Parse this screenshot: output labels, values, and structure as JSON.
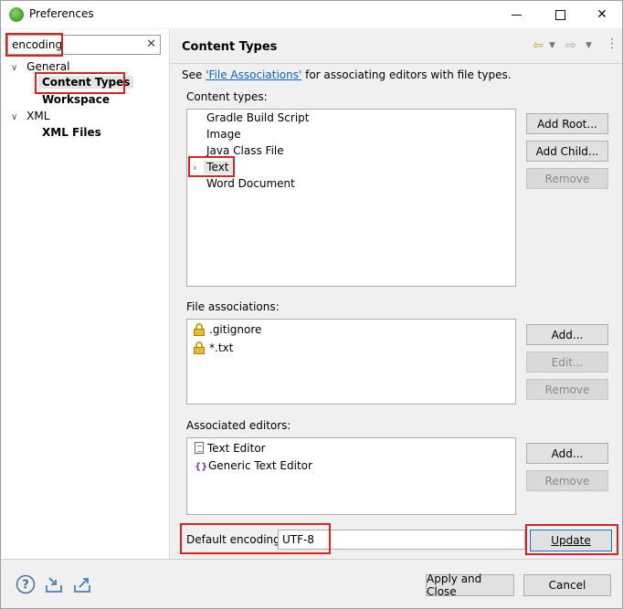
{
  "window": {
    "title": "Preferences"
  },
  "filter": {
    "value": "encoding"
  },
  "tree": {
    "general": "General",
    "content_types": "Content Types",
    "workspace": "Workspace",
    "xml": "XML",
    "xml_files": "XML Files"
  },
  "page": {
    "title": "Content Types",
    "see_prefix": "See ",
    "see_link": "'File Associations'",
    "see_suffix": " for associating editors with file types."
  },
  "content_types": {
    "label": "Content types:",
    "items": [
      "Gradle Build Script",
      "Image",
      "Java Class File",
      "Text",
      "Word Document"
    ],
    "selected": "Text"
  },
  "file_associations": {
    "label": "File associations:",
    "items": [
      ".gitignore",
      "*.txt"
    ]
  },
  "associated_editors": {
    "label": "Associated editors:",
    "items": [
      "Text Editor",
      "Generic Text Editor"
    ]
  },
  "buttons": {
    "add_root": "Add Root...",
    "add_child": "Add Child...",
    "remove": "Remove",
    "add": "Add...",
    "edit": "Edit...",
    "update": "Update",
    "apply_close": "Apply and Close",
    "cancel": "Cancel"
  },
  "encoding": {
    "label": "Default encoding:",
    "value": "UTF-8"
  },
  "colors": {
    "highlight": "#e02020",
    "link": "#0a63c9",
    "primary_border": "#0078d7"
  }
}
